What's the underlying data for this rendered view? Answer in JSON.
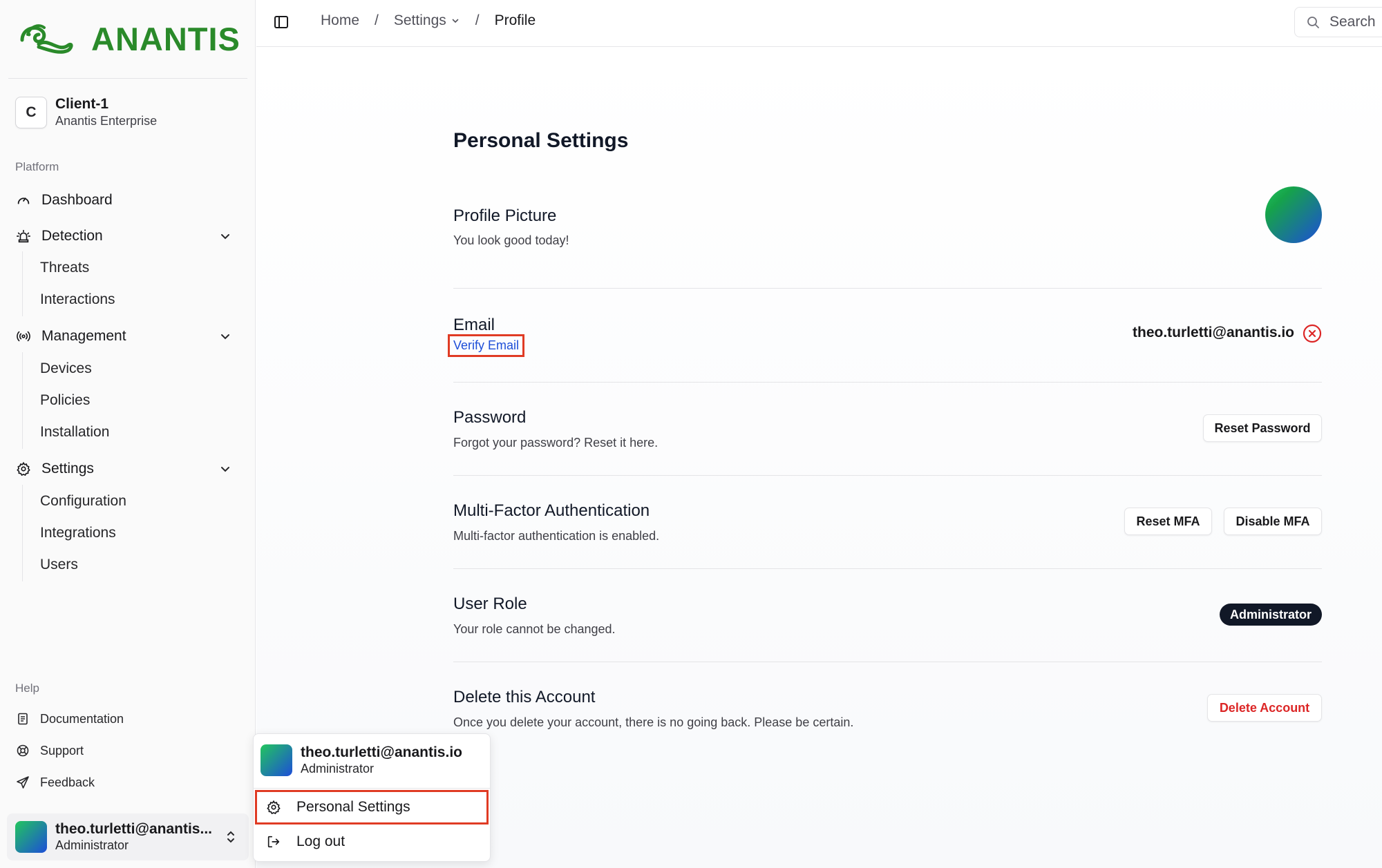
{
  "brand": {
    "name": "ANANTIS"
  },
  "org": {
    "initial": "C",
    "name": "Client-1",
    "plan": "Anantis Enterprise"
  },
  "sidebar": {
    "platform_label": "Platform",
    "dashboard": "Dashboard",
    "detection": {
      "label": "Detection",
      "items": [
        "Threats",
        "Interactions"
      ]
    },
    "management": {
      "label": "Management",
      "items": [
        "Devices",
        "Policies",
        "Installation"
      ]
    },
    "settings": {
      "label": "Settings",
      "items": [
        "Configuration",
        "Integrations",
        "Users"
      ]
    },
    "help_label": "Help",
    "help_items": [
      "Documentation",
      "Support",
      "Feedback"
    ]
  },
  "user": {
    "email_truncated": "theo.turletti@anantis...",
    "email": "theo.turletti@anantis.io",
    "role": "Administrator"
  },
  "header": {
    "breadcrumb": [
      "Home",
      "Settings",
      "Profile"
    ],
    "separator": "/",
    "search_label": "Search"
  },
  "page": {
    "title": "Personal Settings",
    "profile_picture": {
      "title": "Profile Picture",
      "desc": "You look good today!"
    },
    "email": {
      "title": "Email",
      "verify_link": "Verify Email",
      "value": "theo.turletti@anantis.io",
      "verified": false
    },
    "password": {
      "title": "Password",
      "desc": "Forgot your password? Reset it here.",
      "button": "Reset Password"
    },
    "mfa": {
      "title": "Multi-Factor Authentication",
      "desc": "Multi-factor authentication is enabled.",
      "reset_button": "Reset MFA",
      "disable_button": "Disable MFA"
    },
    "role": {
      "title": "User Role",
      "desc": "Your role cannot be changed.",
      "badge": "Administrator"
    },
    "delete": {
      "title": "Delete this Account",
      "desc": "Once you delete your account, there is no going back. Please be certain.",
      "button": "Delete Account"
    }
  },
  "user_menu": {
    "email": "theo.turletti@anantis.io",
    "role": "Administrator",
    "items": [
      "Personal Settings",
      "Log out"
    ]
  },
  "colors": {
    "brand_green": "#2a8a2a",
    "highlight": "#e03b24",
    "link": "#1d4ed8",
    "danger": "#dc2626",
    "badge_bg": "#111827"
  },
  "icons": [
    "snake-logo-icon",
    "dashboard-gauge-icon",
    "siren-icon",
    "radio-signal-icon",
    "gear-icon",
    "chevron-down-icon",
    "document-icon",
    "lifebuoy-icon",
    "send-icon",
    "chevrons-up-down-icon",
    "sidebar-toggle-icon",
    "search-icon",
    "x-circle-icon",
    "logout-icon"
  ]
}
